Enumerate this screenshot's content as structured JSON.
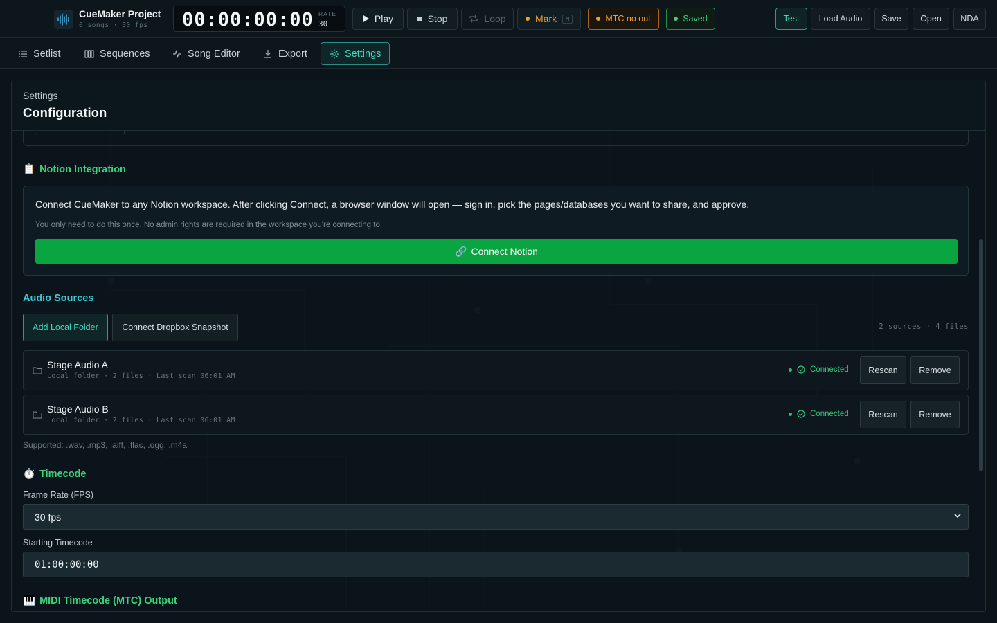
{
  "app": {
    "project_title": "CueMaker Project",
    "project_sub": "0 songs · 30 fps",
    "timecode": "00:00:00:00",
    "rate_label": "RATE",
    "rate_value": "30"
  },
  "transport": {
    "play": "Play",
    "stop": "Stop",
    "loop": "Loop",
    "mark": "Mark",
    "mark_key": "M",
    "mtc": "MTC no out",
    "saved": "Saved"
  },
  "actions": {
    "test": "Test",
    "load_audio": "Load Audio",
    "save": "Save",
    "open": "Open",
    "nda": "NDA"
  },
  "nav": {
    "items": [
      {
        "label": "Setlist",
        "icon": "list-icon"
      },
      {
        "label": "Sequences",
        "icon": "columns-icon"
      },
      {
        "label": "Song Editor",
        "icon": "waveform-icon"
      },
      {
        "label": "Export",
        "icon": "download-icon"
      },
      {
        "label": "Settings",
        "icon": "gear-icon",
        "active": true
      }
    ]
  },
  "panel": {
    "small": "Settings",
    "title": "Configuration"
  },
  "notion": {
    "emoji": "📋",
    "title": "Notion Integration",
    "text": "Connect CueMaker to any Notion workspace. After clicking Connect, a browser window will open — sign in, pick the pages/databases you want to share, and approve.",
    "sub": "You only need to do this once. No admin rights are required in the workspace you're connecting to.",
    "button_emoji": "🔗",
    "button": "Connect Notion"
  },
  "audio_sources": {
    "title": "Audio Sources",
    "add_local": "Add Local Folder",
    "connect_dropbox": "Connect Dropbox Snapshot",
    "count": "2 sources · 4 files",
    "sources": [
      {
        "name": "Stage Audio A",
        "meta": "Local folder · 2 files · Last scan 06:01 AM",
        "status": "Connected",
        "rescan": "Rescan",
        "remove": "Remove"
      },
      {
        "name": "Stage Audio B",
        "meta": "Local folder · 2 files · Last scan 06:01 AM",
        "status": "Connected",
        "rescan": "Rescan",
        "remove": "Remove"
      }
    ],
    "supported": "Supported: .wav, .mp3, .aiff, .flac, .ogg, .m4a"
  },
  "timecode": {
    "emoji": "⏱️",
    "title": "Timecode",
    "fps_label": "Frame Rate (FPS)",
    "fps_value": "30 fps",
    "start_label": "Starting Timecode",
    "start_value": "01:00:00:00"
  },
  "mtc": {
    "emoji": "🎹",
    "title": "MIDI Timecode (MTC) Output"
  },
  "colors": {
    "accent_teal": "#3fd9c0",
    "section_green": "#3ed17a",
    "connect_green": "#08a540",
    "warn_orange": "#f0a030"
  }
}
